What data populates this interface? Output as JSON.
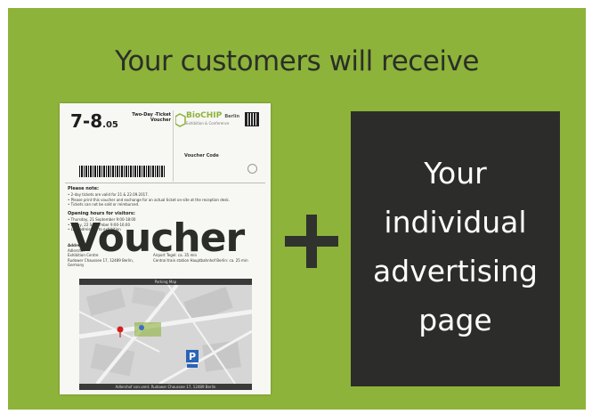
{
  "headline": "Your customers will receive",
  "voucher": {
    "date_main": "7-8",
    "date_sub": ".05",
    "ticket_type": "Two-Day -Ticket Voucher",
    "logo_name": "BioCHIP",
    "logo_suffix": "Berlin",
    "logo_tagline": "Exhibition & Conference",
    "voucher_code_label": "Voucher Code",
    "note_title": "Please note:",
    "note_lines": [
      "• 2-day tickets are valid for 21 & 22.09.2017.",
      "• Please print this voucher and exchange for an actual ticket on-site at the reception desk.",
      "• Tickets can not be sold or reimbursed."
    ],
    "hours_title": "Opening hours for visitors:",
    "hours_lines": [
      "• Thursday, 21 September 9:00-18:00",
      "• Friday, 22 September 9:00-16:00",
      "• Last admission to exhibition"
    ],
    "address_lines": [
      "Address",
      "Adlershof",
      "Exhibition Centre",
      "Rudower Chaussee 17, 12489 Berlin,",
      "Germany"
    ],
    "transport_lines": [
      "Airport Tegel: ca. 35 min",
      "Central train station Hauptbahnhof Berlin: ca. 25 min"
    ],
    "map_title": "Parking Map",
    "map_footer": "Adlershof con.vent. Rudower Chaussee 17, 12489 Berlin",
    "overlay_word": "Voucher"
  },
  "plus_symbol": "+",
  "ad_box": {
    "lines": [
      "Your",
      "individual",
      "advertising",
      "page"
    ]
  },
  "colors": {
    "background": "#8db33a",
    "text_dark": "#2b2f28",
    "box": "#2c2d2b",
    "brand_green": "#8db33a"
  }
}
